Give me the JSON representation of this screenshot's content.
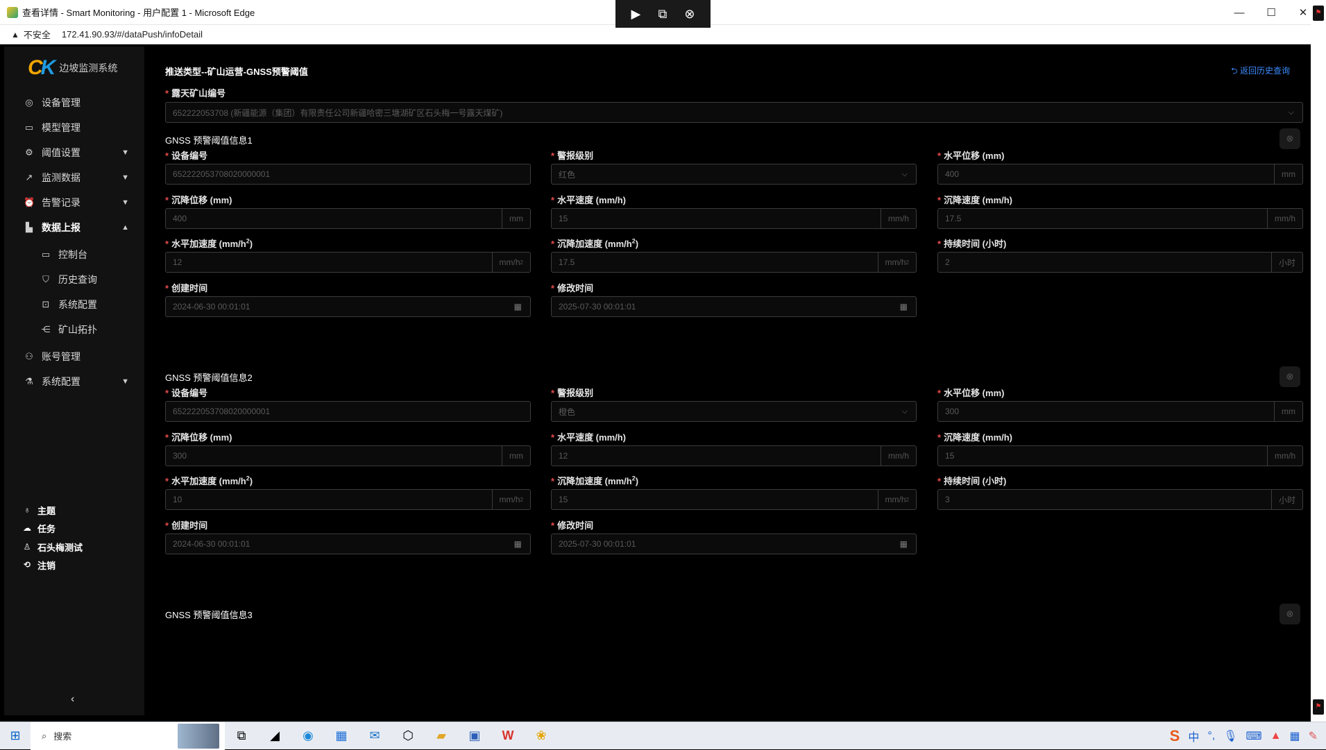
{
  "window": {
    "title": "查看详情 - Smart Monitoring - 用户配置 1 - Microsoft Edge",
    "minimize": "—",
    "maximize": "☐",
    "close": "✕"
  },
  "address": {
    "insecure_label": "不安全",
    "url": "172.41.90.93/#/dataPush/infoDetail"
  },
  "sidebar": {
    "app_name": "边坡监测系统",
    "menu": [
      {
        "label": "设备管理",
        "icon": "location-icon"
      },
      {
        "label": "模型管理",
        "icon": "monitor-icon"
      },
      {
        "label": "阈值设置",
        "icon": "gear-icon"
      },
      {
        "label": "监测数据",
        "icon": "chart-icon"
      },
      {
        "label": "告警记录",
        "icon": "alarm-icon"
      },
      {
        "label": "数据上报",
        "icon": "bar-chart-icon"
      }
    ],
    "submenu": [
      {
        "label": "控制台",
        "icon": "console-icon"
      },
      {
        "label": "历史查询",
        "icon": "shield-icon"
      },
      {
        "label": "系统配置",
        "icon": "config-icon"
      },
      {
        "label": "矿山拓扑",
        "icon": "topology-icon"
      }
    ],
    "menu2": [
      {
        "label": "账号管理",
        "icon": "user-icon"
      },
      {
        "label": "系统配置",
        "icon": "flask-icon"
      }
    ],
    "bottom": [
      {
        "label": "主题",
        "icon": "shirt-icon"
      },
      {
        "label": "任务",
        "icon": "cloud-icon"
      },
      {
        "label": "石头梅测试",
        "icon": "user-icon"
      },
      {
        "label": "注销",
        "icon": "logout-icon"
      }
    ]
  },
  "page": {
    "heading": "推送类型--矿山运营-GNSS预警阈值",
    "back_link": "返回历史查询",
    "mine_label": "露天矿山编号",
    "mine_value": "652222053708 (新疆能源（集团）有限责任公司新疆哈密三塘湖矿区石头梅一号露天煤矿)"
  },
  "labels": {
    "device_id": "设备编号",
    "alarm_level": "警报级别",
    "h_disp": "水平位移 (mm)",
    "s_disp": "沉降位移 (mm)",
    "h_speed": "水平速度 (mm/h)",
    "s_speed": "沉降速度 (mm/h)",
    "h_acc": "水平加速度 (mm/h",
    "s_acc": "沉降加速度 (mm/h",
    "duration": "持续时间 (小时)",
    "created": "创建时间",
    "modified": "修改时间",
    "acc_sup": "2",
    "acc_close": ")"
  },
  "units": {
    "mm": "mm",
    "mmh": "mm/h",
    "mmh2": "mm/h",
    "sup2": "2",
    "hour": "小时"
  },
  "sections": [
    {
      "title": "GNSS 预警阈值信息1",
      "device_id": "652222053708020000001",
      "alarm_level": "红色",
      "h_disp": "400",
      "s_disp": "400",
      "h_speed": "15",
      "s_speed": "17.5",
      "h_acc": "12",
      "s_acc": "17.5",
      "duration": "2",
      "created": "2024-06-30 00:01:01",
      "modified": "2025-07-30 00:01:01"
    },
    {
      "title": "GNSS 预警阈值信息2",
      "device_id": "652222053708020000001",
      "alarm_level": "橙色",
      "h_disp": "300",
      "s_disp": "300",
      "h_speed": "12",
      "s_speed": "15",
      "h_acc": "10",
      "s_acc": "15",
      "duration": "3",
      "created": "2024-06-30 00:01:01",
      "modified": "2025-07-30 00:01:01"
    },
    {
      "title": "GNSS 预警阈值信息3"
    }
  ],
  "taskbar": {
    "search": "搜索",
    "ime": "中"
  }
}
